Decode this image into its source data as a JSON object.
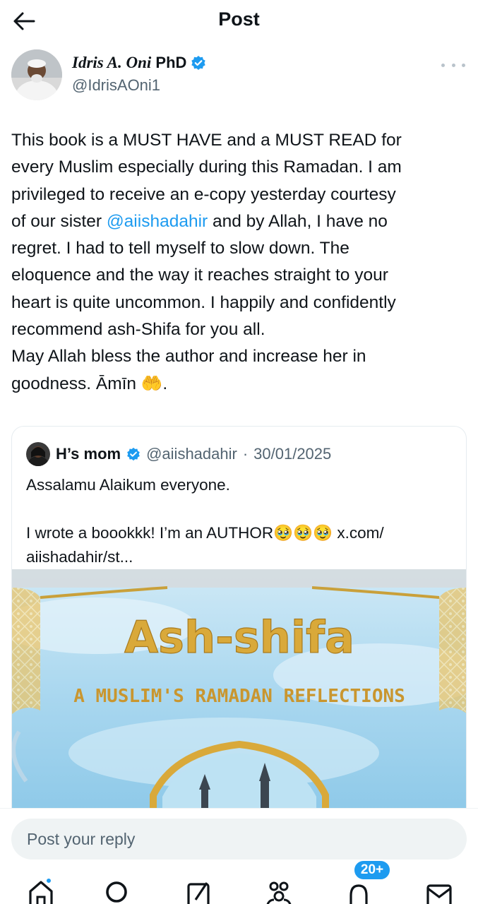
{
  "header": {
    "title": "Post"
  },
  "author": {
    "name_italic": "Idris A. Oni",
    "name_suffix": "PhD",
    "handle": "@IdrisAOni1"
  },
  "post": {
    "lines": [
      "This book is a MUST HAVE and a MUST READ for",
      "every Muslim especially during this Ramadan. I am",
      "privileged to receive an e-copy yesterday courtesy",
      "of our sister ",
      "regret. I had to tell myself to slow down. The",
      "eloquence and the way it reaches straight to your",
      "heart is quite uncommon. I happily and confidently",
      "recommend ash-Shifa for you all.",
      "May Allah bless the author and increase her in",
      "goodness. Āmīn 🤲."
    ],
    "mention": "@aiishadahir",
    "line4_rest": " and by Allah, I have no"
  },
  "quote": {
    "name": "H’s mom",
    "handle": "@aiishadahir",
    "separator": "·",
    "date": "30/01/2025",
    "line1": "Assalamu Alaikum everyone.",
    "line2": "I wrote a boookkk! I’m an AUTHOR🥹🥹🥹 x.com/",
    "line3": "aiishadahir/st...",
    "image": {
      "title": "Ash-shifa",
      "subtitle": "A MUSLIM'S RAMADAN REFLECTIONS"
    }
  },
  "reply": {
    "placeholder": "Post your reply"
  },
  "nav": {
    "items": [
      "home-icon",
      "search-icon",
      "compose-icon",
      "communities-icon",
      "notifications-icon",
      "messages-icon"
    ],
    "notifications_badge": "20+"
  },
  "colors": {
    "accent": "#1d9bf0",
    "text": "#0f1419",
    "muted": "#536471",
    "gold": "#c9a03a",
    "sky": "#9fd3ec"
  }
}
